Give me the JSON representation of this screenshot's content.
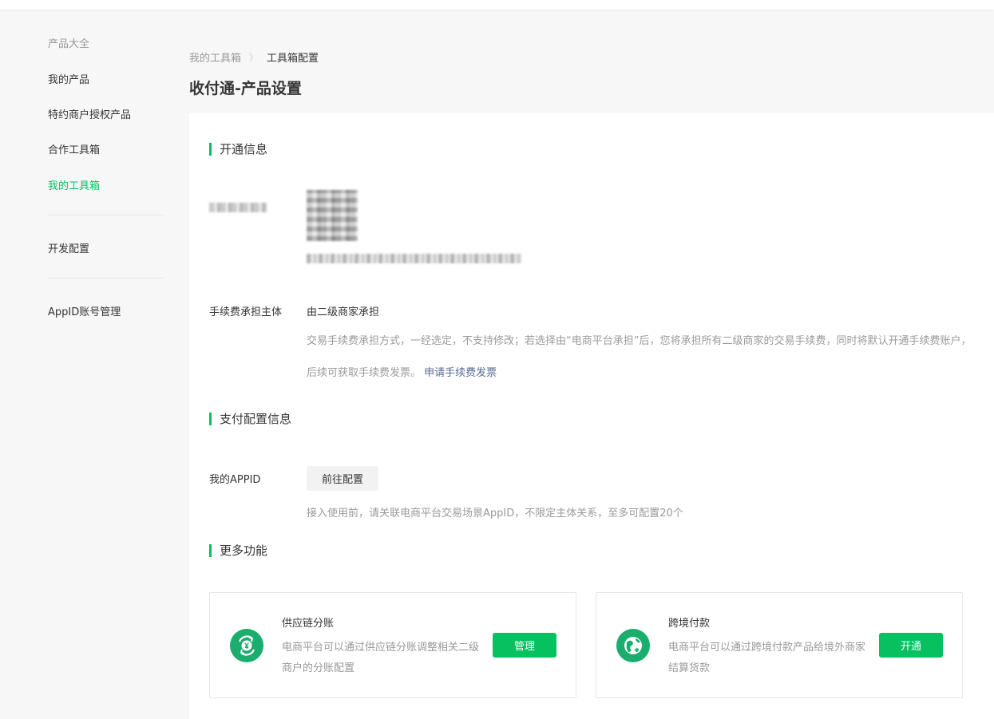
{
  "colors": {
    "accent": "#07c160",
    "link": "#576b95",
    "muted": "#999999"
  },
  "sidebar": {
    "group_title": "产品大全",
    "items": [
      {
        "label": "我的产品"
      },
      {
        "label": "特约商户授权产品"
      },
      {
        "label": "合作工具箱"
      },
      {
        "label": "我的工具箱",
        "active": true
      },
      {
        "label": "开发配置"
      },
      {
        "label": "AppID账号管理"
      }
    ]
  },
  "breadcrumb": {
    "parent": "我的工具箱",
    "current": "工具箱配置"
  },
  "page_title": "收付通-产品设置",
  "sections": {
    "open_info": {
      "title": "开通信息",
      "fee_label": "手续费承担主体",
      "fee_value": "由二级商家承担",
      "fee_desc": "交易手续费承担方式，一经选定，不支持修改；若选择由“电商平台承担”后，您将承担所有二级商家的交易手续费，同时将默认开通手续费账户，后续可获取手续费发票。",
      "fee_link": "申请手续费发票"
    },
    "pay_config": {
      "title": "支付配置信息",
      "appid_label": "我的APPID",
      "config_button": "前往配置",
      "appid_desc": "接入使用前，请关联电商平台交易场景AppID，不限定主体关系，至多可配置20个"
    },
    "more": {
      "title": "更多功能",
      "cards": [
        {
          "title": "供应链分账",
          "desc": "电商平台可以通过供应链分账调整相关二级商户的分账配置",
          "button": "管理",
          "icon": "yuan-cycle-icon"
        },
        {
          "title": "跨境付款",
          "desc": "电商平台可以通过跨境付款产品给境外商家结算货款",
          "button": "开通",
          "icon": "globe-icon"
        }
      ]
    }
  }
}
